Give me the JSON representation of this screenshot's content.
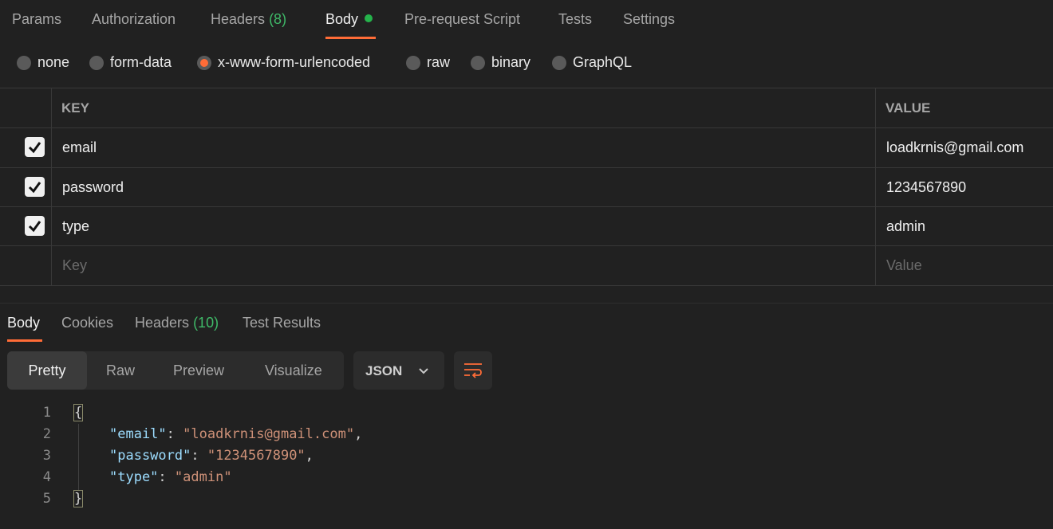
{
  "request_tabs": {
    "params": "Params",
    "authorization": "Authorization",
    "headers": "Headers",
    "headers_count": "(8)",
    "body": "Body",
    "prerequest": "Pre-request Script",
    "tests": "Tests",
    "settings": "Settings"
  },
  "body_modes": [
    "none",
    "form-data",
    "x-www-form-urlencoded",
    "raw",
    "binary",
    "GraphQL"
  ],
  "selected_mode": "x-www-form-urlencoded",
  "table": {
    "key_header": "KEY",
    "value_header": "VALUE",
    "rows": [
      {
        "key": "email",
        "value": "loadkrnis@gmail.com",
        "checked": true
      },
      {
        "key": "password",
        "value": "1234567890",
        "checked": true
      },
      {
        "key": "type",
        "value": "admin",
        "checked": true
      }
    ],
    "key_placeholder": "Key",
    "value_placeholder": "Value"
  },
  "response_tabs": {
    "body": "Body",
    "cookies": "Cookies",
    "headers": "Headers",
    "headers_count": "(10)",
    "test_results": "Test Results"
  },
  "view_modes": [
    "Pretty",
    "Raw",
    "Preview",
    "Visualize"
  ],
  "format": "JSON",
  "code": {
    "line_numbers": [
      "1",
      "2",
      "3",
      "4",
      "5"
    ],
    "open_brace": "{",
    "close_brace": "}",
    "lines": [
      {
        "key": "\"email\"",
        "value": "\"loadkrnis@gmail.com\"",
        "comma": ","
      },
      {
        "key": "\"password\"",
        "value": "\"1234567890\"",
        "comma": ","
      },
      {
        "key": "\"type\"",
        "value": "\"admin\"",
        "comma": ""
      }
    ]
  },
  "colors": {
    "accent": "#ff6c37",
    "success": "#25b34b",
    "background": "#212121"
  }
}
